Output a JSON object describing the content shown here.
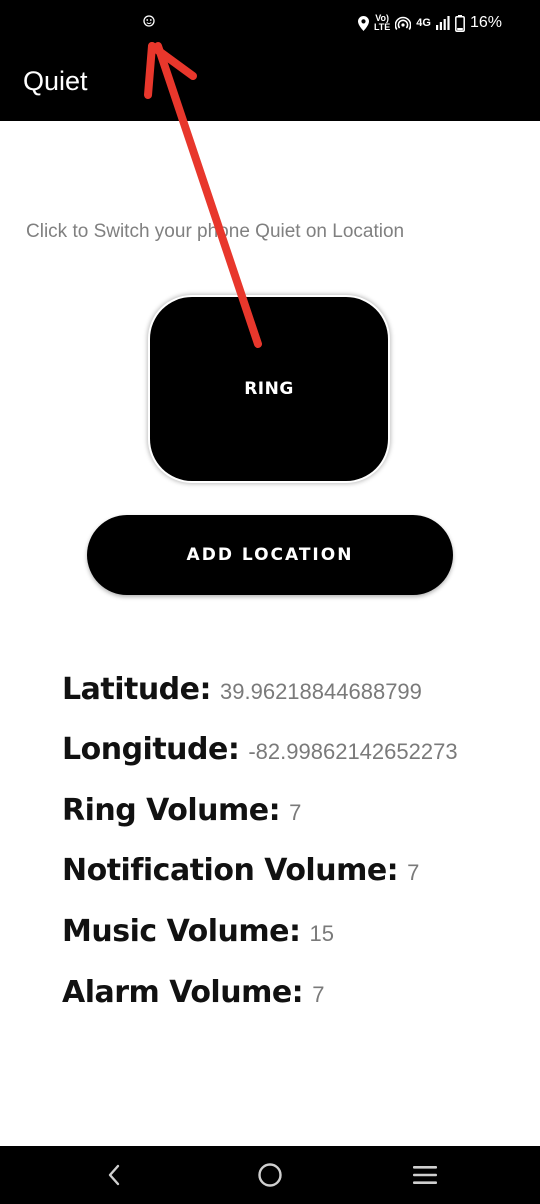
{
  "status_bar": {
    "left_icon": "face-icon",
    "icons": [
      "location-icon",
      "volte-icon",
      "hotspot-icon",
      "signal-icon",
      "battery-icon"
    ],
    "volte_top": "Vo)",
    "volte_bottom": "LTE",
    "network": "4G",
    "battery": "16%"
  },
  "app_bar": {
    "title": "Quiet"
  },
  "main": {
    "subtitle": "Click to Switch your phone Quiet on Location",
    "mode_button": "RING",
    "add_location_button": "ADD LOCATION",
    "info": [
      {
        "label": "Latitude:",
        "value": "39.96218844688799"
      },
      {
        "label": "Longitude:",
        "value": "-82.99862142652273"
      },
      {
        "label": "Ring Volume:",
        "value": "7"
      },
      {
        "label": "Notification Volume:",
        "value": "7"
      },
      {
        "label": "Music Volume:",
        "value": "15"
      },
      {
        "label": "Alarm Volume:",
        "value": "7"
      }
    ]
  },
  "nav_bar": {
    "icons": [
      "back-icon",
      "home-icon",
      "recents-menu-icon"
    ]
  },
  "annotation": {
    "color": "#e8372c"
  },
  "colors": {
    "bar_background": "#000000",
    "subtitle_text": "#808080",
    "value_text": "#7a7a7a"
  }
}
